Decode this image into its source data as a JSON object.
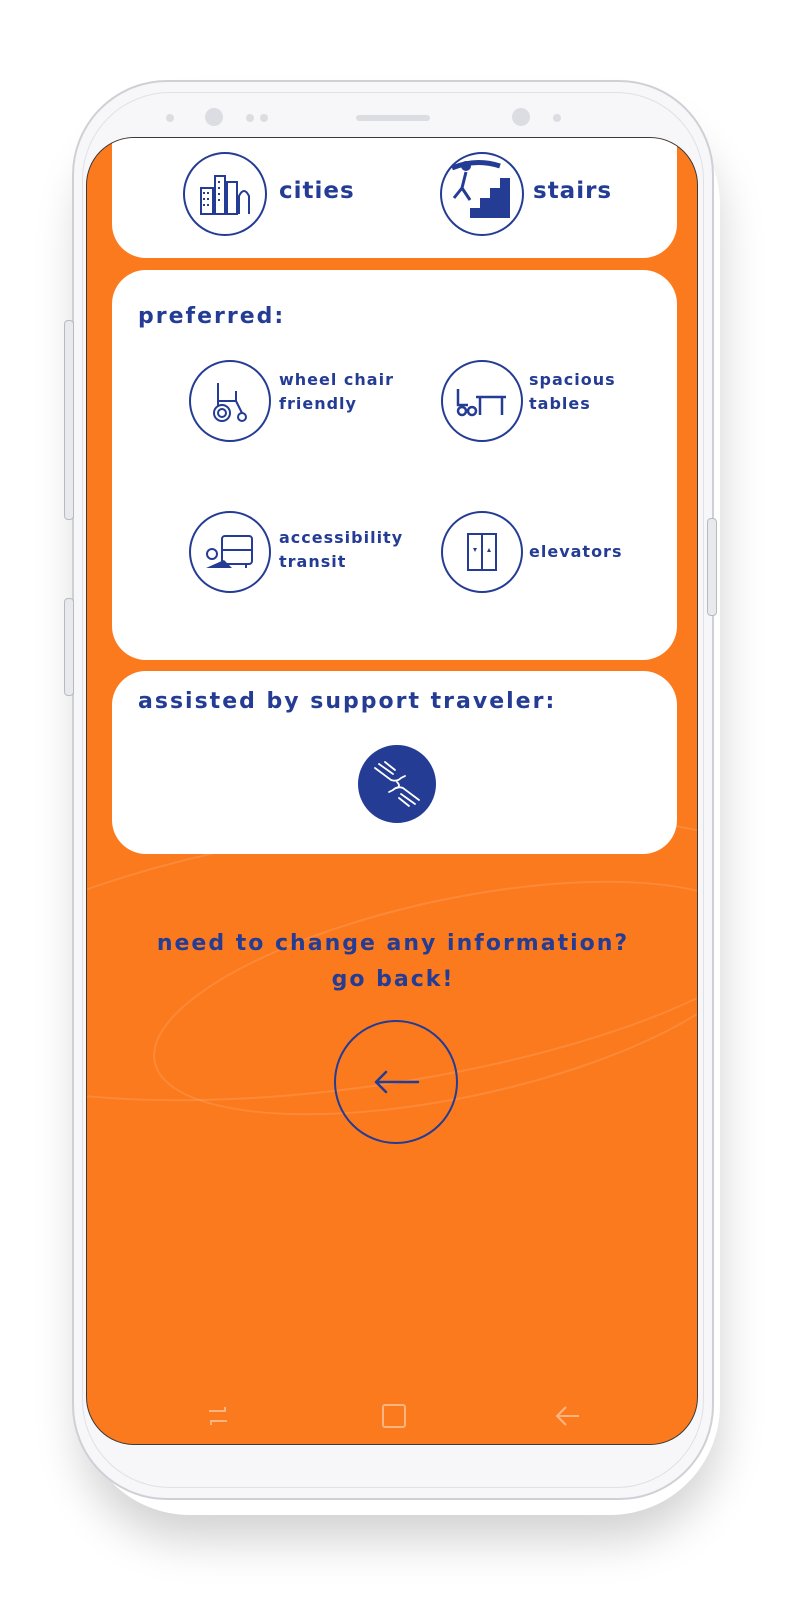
{
  "card_top": {
    "cities_label": "cities",
    "stairs_label": "stairs"
  },
  "preferred": {
    "title": "preferred:",
    "options": [
      {
        "line1": "wheel chair",
        "line2": "friendly",
        "icon": "wheelchair-icon"
      },
      {
        "line1": "spacious",
        "line2": "tables",
        "icon": "table-icon"
      },
      {
        "line1": "accessibility",
        "line2": "transit",
        "icon": "bus-icon"
      },
      {
        "line1": "elevators",
        "line2": "",
        "icon": "elevator-icon"
      }
    ]
  },
  "support": {
    "title": "assisted by support traveler:",
    "icon": "helping-hands-icon"
  },
  "cta": {
    "line1": "need to change any information?",
    "line2": "go back!"
  },
  "colors": {
    "background": "#fc7a1e",
    "navy": "#243c94",
    "card": "#ffffff"
  }
}
